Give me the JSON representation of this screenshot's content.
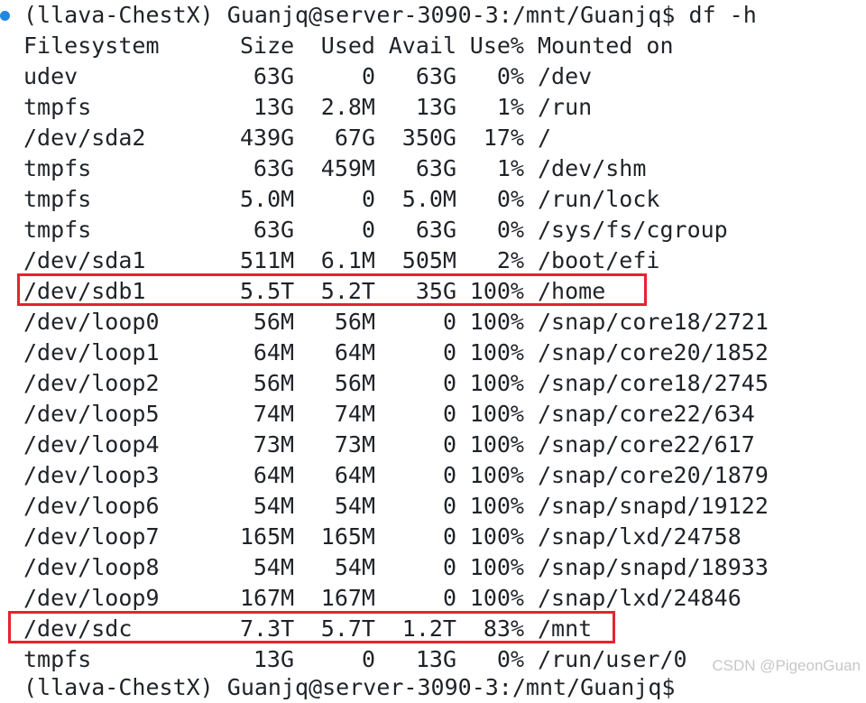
{
  "prompt": {
    "text": "(llava-ChestX) Guanjq@server-3090-3:/mnt/Guanjq$ df -h",
    "status_color": "#1e88e5"
  },
  "table": {
    "headers": [
      "Filesystem",
      "Size",
      "Used",
      "Avail",
      "Use%",
      "Mounted on"
    ],
    "rows": [
      [
        "udev",
        "63G",
        "0",
        "63G",
        "0%",
        "/dev"
      ],
      [
        "tmpfs",
        "13G",
        "2.8M",
        "13G",
        "1%",
        "/run"
      ],
      [
        "/dev/sda2",
        "439G",
        "67G",
        "350G",
        "17%",
        "/"
      ],
      [
        "tmpfs",
        "63G",
        "459M",
        "63G",
        "1%",
        "/dev/shm"
      ],
      [
        "tmpfs",
        "5.0M",
        "0",
        "5.0M",
        "0%",
        "/run/lock"
      ],
      [
        "tmpfs",
        "63G",
        "0",
        "63G",
        "0%",
        "/sys/fs/cgroup"
      ],
      [
        "/dev/sda1",
        "511M",
        "6.1M",
        "505M",
        "2%",
        "/boot/efi"
      ],
      [
        "/dev/sdb1",
        "5.5T",
        "5.2T",
        "35G",
        "100%",
        "/home"
      ],
      [
        "/dev/loop0",
        "56M",
        "56M",
        "0",
        "100%",
        "/snap/core18/2721"
      ],
      [
        "/dev/loop1",
        "64M",
        "64M",
        "0",
        "100%",
        "/snap/core20/1852"
      ],
      [
        "/dev/loop2",
        "56M",
        "56M",
        "0",
        "100%",
        "/snap/core18/2745"
      ],
      [
        "/dev/loop5",
        "74M",
        "74M",
        "0",
        "100%",
        "/snap/core22/634"
      ],
      [
        "/dev/loop4",
        "73M",
        "73M",
        "0",
        "100%",
        "/snap/core22/617"
      ],
      [
        "/dev/loop3",
        "64M",
        "64M",
        "0",
        "100%",
        "/snap/core20/1879"
      ],
      [
        "/dev/loop6",
        "54M",
        "54M",
        "0",
        "100%",
        "/snap/snapd/19122"
      ],
      [
        "/dev/loop7",
        "165M",
        "165M",
        "0",
        "100%",
        "/snap/lxd/24758"
      ],
      [
        "/dev/loop8",
        "54M",
        "54M",
        "0",
        "100%",
        "/snap/snapd/18933"
      ],
      [
        "/dev/loop9",
        "167M",
        "167M",
        "0",
        "100%",
        "/snap/lxd/24846"
      ],
      [
        "/dev/sdc",
        "7.3T",
        "5.7T",
        "1.2T",
        "83%",
        "/mnt"
      ],
      [
        "tmpfs",
        "13G",
        "0",
        "13G",
        "0%",
        "/run/user/0"
      ]
    ],
    "highlighted_rows": [
      7,
      18
    ],
    "highlight_color": "#e5232f"
  },
  "next_prompt_partial": "(llava-ChestX) Guanjq@server-3090-3:/mnt/Guanjq$",
  "watermark": "CSDN @PigeonGuan"
}
